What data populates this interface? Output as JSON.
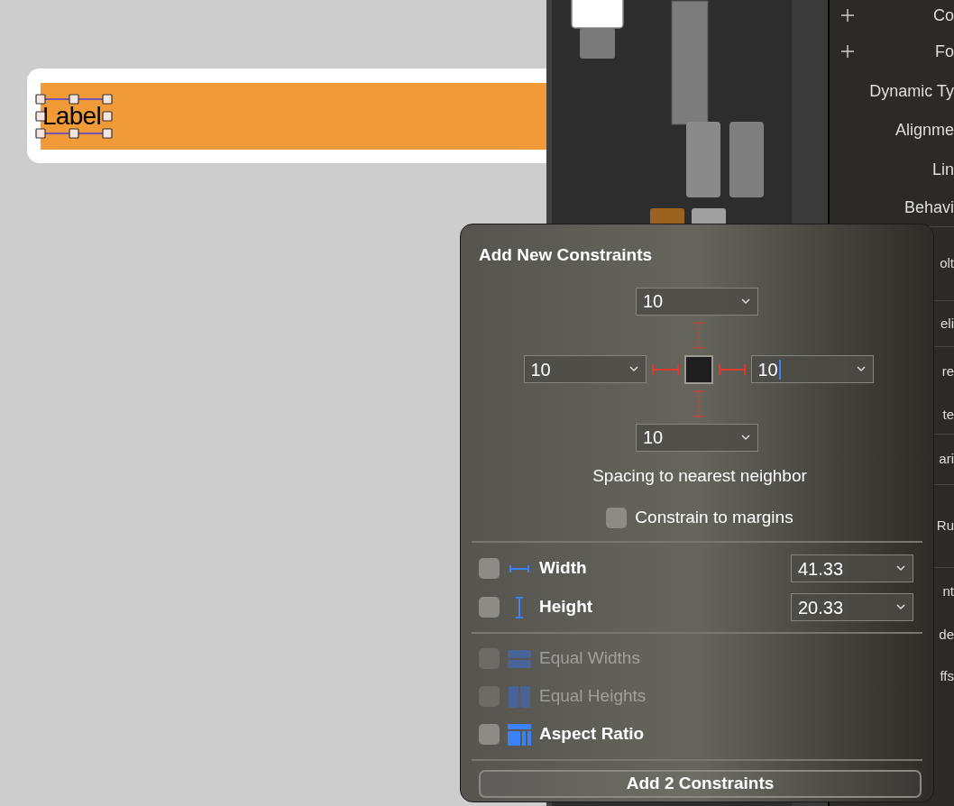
{
  "canvas": {
    "label": {
      "text": "Label",
      "selected": true
    }
  },
  "inspector": {
    "rows": [
      {
        "text": "Co",
        "kind": "add"
      },
      {
        "text": "Fo",
        "kind": "add"
      },
      {
        "text": "Dynamic Ty",
        "kind": "plain"
      },
      {
        "text": "Alignme",
        "kind": "plain"
      },
      {
        "text": "Lin",
        "kind": "plain"
      },
      {
        "text": "Behavi",
        "kind": "plain"
      },
      {
        "text": "olt",
        "kind": "plain"
      },
      {
        "text": "eli",
        "kind": "plain"
      },
      {
        "text": "re",
        "kind": "plain"
      },
      {
        "text": "te",
        "kind": "plain"
      },
      {
        "text": "ari",
        "kind": "plain"
      },
      {
        "text": "Ru",
        "kind": "plain"
      },
      {
        "text": "nt",
        "kind": "plain"
      },
      {
        "text": "de",
        "kind": "plain"
      },
      {
        "text": "ffs",
        "kind": "plain"
      }
    ]
  },
  "popover": {
    "title": "Add New Constraints",
    "spacing": {
      "top": {
        "value": "10",
        "active": false,
        "focused": false
      },
      "left": {
        "value": "10",
        "active": true,
        "focused": false
      },
      "right": {
        "value": "10",
        "active": true,
        "focused": true
      },
      "bottom": {
        "value": "10",
        "active": false,
        "focused": false
      }
    },
    "spacing_caption": "Spacing to nearest neighbor",
    "constrain_to_margins": {
      "label": "Constrain to margins",
      "checked": false
    },
    "size_rows": [
      {
        "kind": "width",
        "label": "Width",
        "checked": false,
        "value": "41.33"
      },
      {
        "kind": "height",
        "label": "Height",
        "checked": false,
        "value": "20.33"
      }
    ],
    "equal_rows": [
      {
        "kind": "equal-widths",
        "label": "Equal Widths",
        "checked": false,
        "disabled": true
      },
      {
        "kind": "equal-heights",
        "label": "Equal Heights",
        "checked": false,
        "disabled": true
      },
      {
        "kind": "aspect-ratio",
        "label": "Aspect Ratio",
        "checked": false,
        "disabled": false
      }
    ],
    "add_button": "Add 2 Constraints"
  }
}
